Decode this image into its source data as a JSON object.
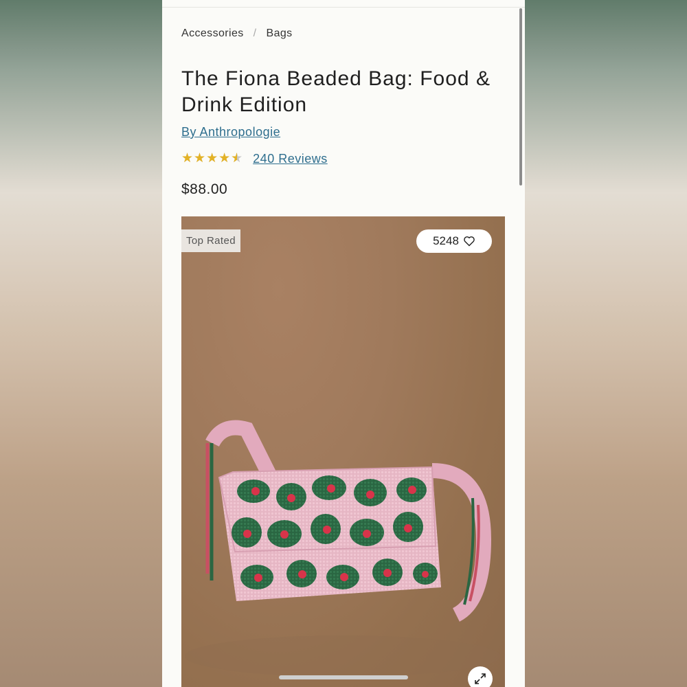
{
  "breadcrumb": {
    "items": [
      "Accessories",
      "Bags"
    ],
    "separator": "/"
  },
  "product": {
    "title": "The Fiona Beaded Bag: Food & Drink Edition",
    "brand": "By Anthropologie",
    "rating": 4.5,
    "reviews_label": "240 Reviews",
    "price": "$88.00"
  },
  "image": {
    "badge": "Top Rated",
    "likes": "5248",
    "icons": {
      "like": "heart-icon",
      "expand": "expand-icon"
    }
  },
  "colors": {
    "link": "#2e6e8e",
    "star": "#e3b226",
    "bag_pink": "#e8b7c7",
    "bag_green": "#2d6b45",
    "bag_red": "#d8344a"
  }
}
